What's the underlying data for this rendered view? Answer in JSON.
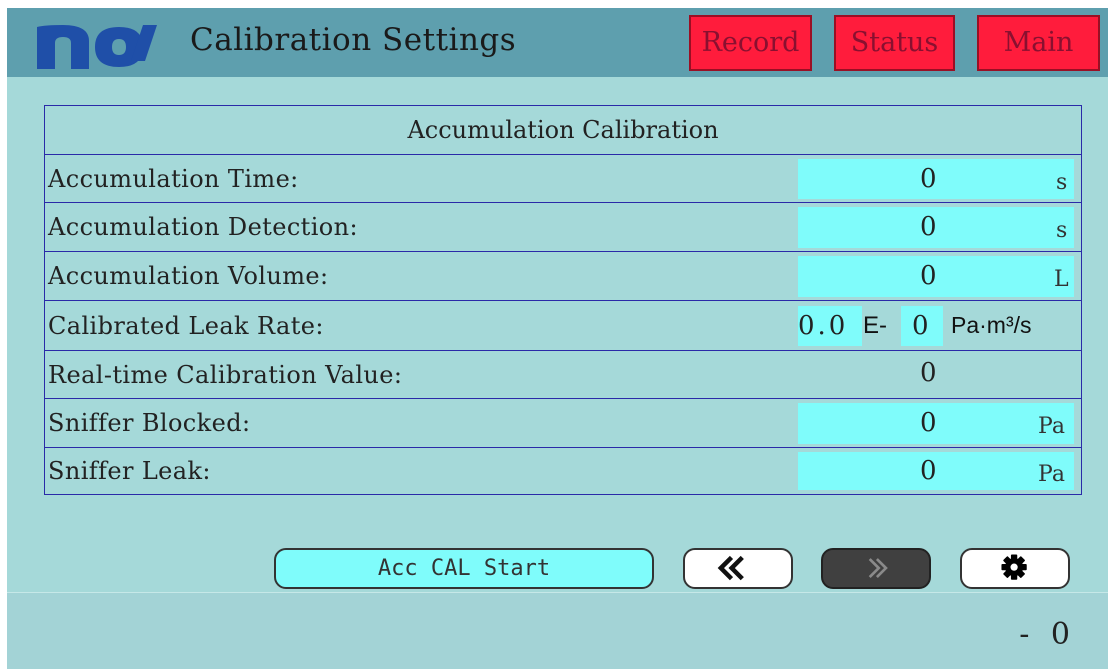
{
  "header": {
    "title": "Calibration Settings",
    "nav": {
      "record_label": "Record",
      "status_label": "Status",
      "main_label": "Main"
    }
  },
  "table": {
    "heading": "Accumulation Calibration",
    "rows": [
      {
        "label": "Accumulation Time:",
        "value": "0",
        "unit": "s",
        "editable": true
      },
      {
        "label": "Accumulation Detection:",
        "value": "0",
        "unit": "s",
        "editable": true
      },
      {
        "label": "Accumulation Volume:",
        "value": "0",
        "unit": "L",
        "editable": true
      },
      {
        "label": "Calibrated Leak Rate:",
        "mantissa": "0.0",
        "exp_prefix": "E-",
        "exponent": "0",
        "unit": "Pa·m³/s",
        "editable": true
      },
      {
        "label": "Real-time Calibration Value:",
        "value": "0",
        "unit": "",
        "editable": false
      },
      {
        "label": "Sniffer Blocked:",
        "value": "0",
        "unit": "Pa",
        "editable": true
      },
      {
        "label": "Sniffer Leak:",
        "value": "0",
        "unit": "Pa",
        "editable": true
      }
    ]
  },
  "buttons": {
    "acc_cal_start": "Acc CAL Start",
    "prev_icon": "double-chevron-left-icon",
    "next_icon": "double-chevron-right-icon",
    "settings_icon": "gear-icon"
  },
  "footer": {
    "value": "- 0"
  },
  "colors": {
    "background": "#a5d9d9",
    "header": "#5e9fae",
    "nav_button": "#ff1c3c",
    "input_cell": "#7ffcfb",
    "table_border": "#2a2aa8",
    "logo": "#1f4fa8"
  }
}
